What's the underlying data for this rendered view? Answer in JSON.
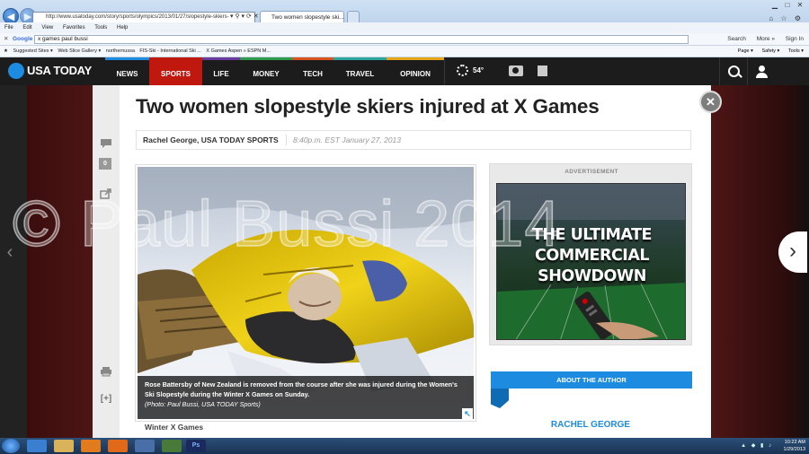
{
  "browser": {
    "address": "http://www.usatoday.com/story/sports/olympics/2013/01/27/slopestyle-skiers-",
    "tab_title": "Two women slopestyle ski...",
    "menu": [
      "File",
      "Edit",
      "View",
      "Favorites",
      "Tools",
      "Help"
    ],
    "google_query": "x games paul bussi",
    "google_right": [
      "Search",
      "More »",
      "Sign In"
    ],
    "favorites": [
      "Suggested Sites ▾",
      "Web Slice Gallery ▾",
      "northernussa",
      "FIS-Ski - International Ski ...",
      "X Games Aspen » ESPN M..."
    ],
    "command_right": [
      "Page ▾",
      "Safety ▾",
      "Tools ▾"
    ]
  },
  "site": {
    "logo": "USA TODAY",
    "nav": [
      "NEWS",
      "SPORTS",
      "LIFE",
      "MONEY",
      "TECH",
      "TRAVEL",
      "OPINION"
    ],
    "weather": "54°",
    "colors": {
      "news": "#1d8ce0",
      "sports": "#c0170f",
      "life": "#6a3b9e",
      "money": "#2d9b4a",
      "tech": "#d9531e",
      "travel": "#2aa5a0",
      "opinion": "#e6a417"
    }
  },
  "article": {
    "headline": "Two women slopestyle skiers injured at X Games",
    "author": "Rachel George, USA TODAY SPORTS",
    "timestamp": "8:40p.m. EST January 27, 2013",
    "comment_count": "0",
    "caption": "Rose Battersby of New Zealand is removed from the course after she was injured during the Women's Ski Slopestyle during the Winter X Games on Sunday.",
    "credit": "(Photo: Paul Bussi, USA TODAY Sports)",
    "section": "Winter X Games"
  },
  "ad": {
    "label": "ADVERTISEMENT",
    "line1": "THE ULTIMATE",
    "line2": "COMMERCIAL",
    "line3": "SHOWDOWN"
  },
  "author_box": {
    "title": "ABOUT THE AUTHOR",
    "name": "RACHEL GEORGE"
  },
  "watermark": "© Paul Bussi 2014",
  "clock": {
    "time": "10:22 AM",
    "date": "1/29/2013"
  }
}
